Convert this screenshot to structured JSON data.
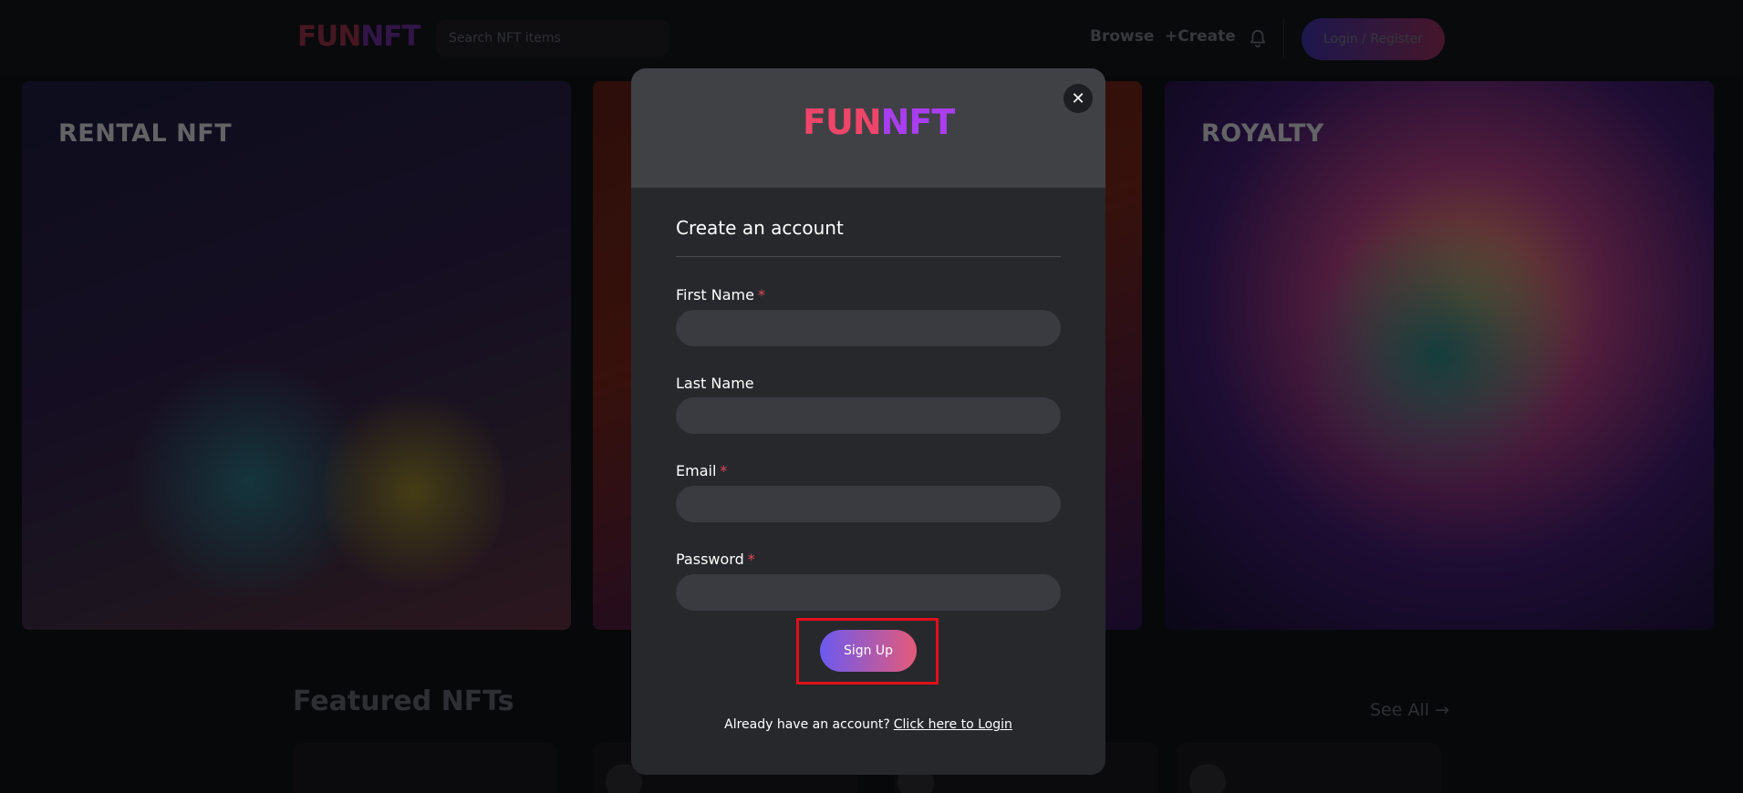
{
  "header": {
    "logo_fun": "FUN",
    "logo_nft": "NFT",
    "search_placeholder": "Search NFT items",
    "nav_browse": "Browse",
    "nav_create": "+Create",
    "login_button": "Login / Register"
  },
  "hero": {
    "cards": [
      {
        "title": "RENTAL NFT"
      },
      {
        "title": ""
      },
      {
        "title": "ROYALTY"
      }
    ]
  },
  "featured": {
    "title": "Featured NFTs",
    "see_all": "See All →"
  },
  "modal": {
    "logo_fun": "FUN",
    "logo_nft": "NFT",
    "close_label": "✕",
    "title": "Create an account",
    "fields": [
      {
        "label": "First Name",
        "required": "*",
        "value": ""
      },
      {
        "label": "Last Name",
        "required": "",
        "value": ""
      },
      {
        "label": "Email",
        "required": "*",
        "value": ""
      },
      {
        "label": "Password",
        "required": "*",
        "value": ""
      }
    ],
    "signup_button": "Sign Up",
    "login_prompt": "Already have an account?",
    "login_link": "Click here to Login"
  },
  "colors": {
    "accent_gradient_start": "#6b5af0",
    "accent_gradient_end": "#e45a78",
    "required_star": "#e0485a",
    "highlight_box": "#e0101a",
    "modal_background": "#27282c"
  }
}
